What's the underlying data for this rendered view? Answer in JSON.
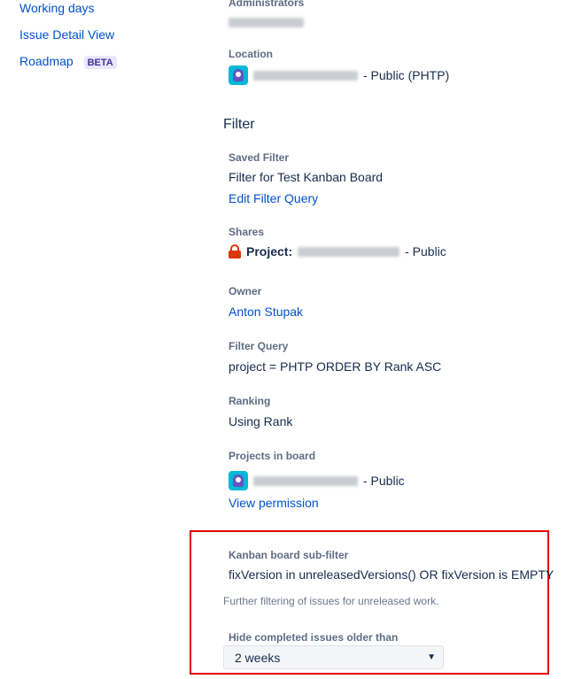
{
  "sidebar": {
    "items": [
      {
        "label": "Working days"
      },
      {
        "label": "Issue Detail View"
      },
      {
        "label": "Roadmap",
        "badge": "BETA"
      }
    ]
  },
  "general": {
    "administrators_label": "Administrators",
    "location_label": "Location",
    "location_suffix": "- Public (PHTP)"
  },
  "filter": {
    "section_title": "Filter",
    "saved_filter_label": "Saved Filter",
    "saved_filter_value": "Filter for Test Kanban Board",
    "edit_filter_link": "Edit Filter Query",
    "shares_label": "Shares",
    "shares_project_prefix": "Project:",
    "shares_suffix": "- Public",
    "owner_label": "Owner",
    "owner_value": "Anton Stupak",
    "filter_query_label": "Filter Query",
    "filter_query_value": "project = PHTP ORDER BY Rank ASC",
    "ranking_label": "Ranking",
    "ranking_value": "Using Rank",
    "projects_label": "Projects in board",
    "projects_suffix": "- Public",
    "view_permission_link": "View permission"
  },
  "kanban": {
    "subfilter_label": "Kanban board sub-filter",
    "subfilter_value": "fixVersion in unreleasedVersions() OR fixVersion is EMPTY",
    "subfilter_help": "Further filtering of issues for unreleased work.",
    "hide_completed_label": "Hide completed issues older than",
    "hide_completed_selected": "2 weeks"
  },
  "colors": {
    "link": "#0052cc",
    "highlight": "#e00000",
    "badge_bg": "#eae6ff",
    "lock": "#de350b"
  },
  "icons": {
    "project": "project-avatar-icon",
    "lock": "lock-icon",
    "dropdown": "chevron-down-icon"
  }
}
